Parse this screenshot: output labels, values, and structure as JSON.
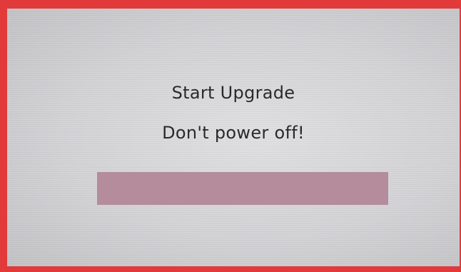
{
  "screen": {
    "title": "Start Upgrade",
    "subtitle": "Don't power off!"
  },
  "progress": {
    "fraction": 1.0,
    "fill_color": "#b48c9c"
  },
  "colors": {
    "frame": "#e23a3a",
    "text": "#2a2a2c"
  }
}
